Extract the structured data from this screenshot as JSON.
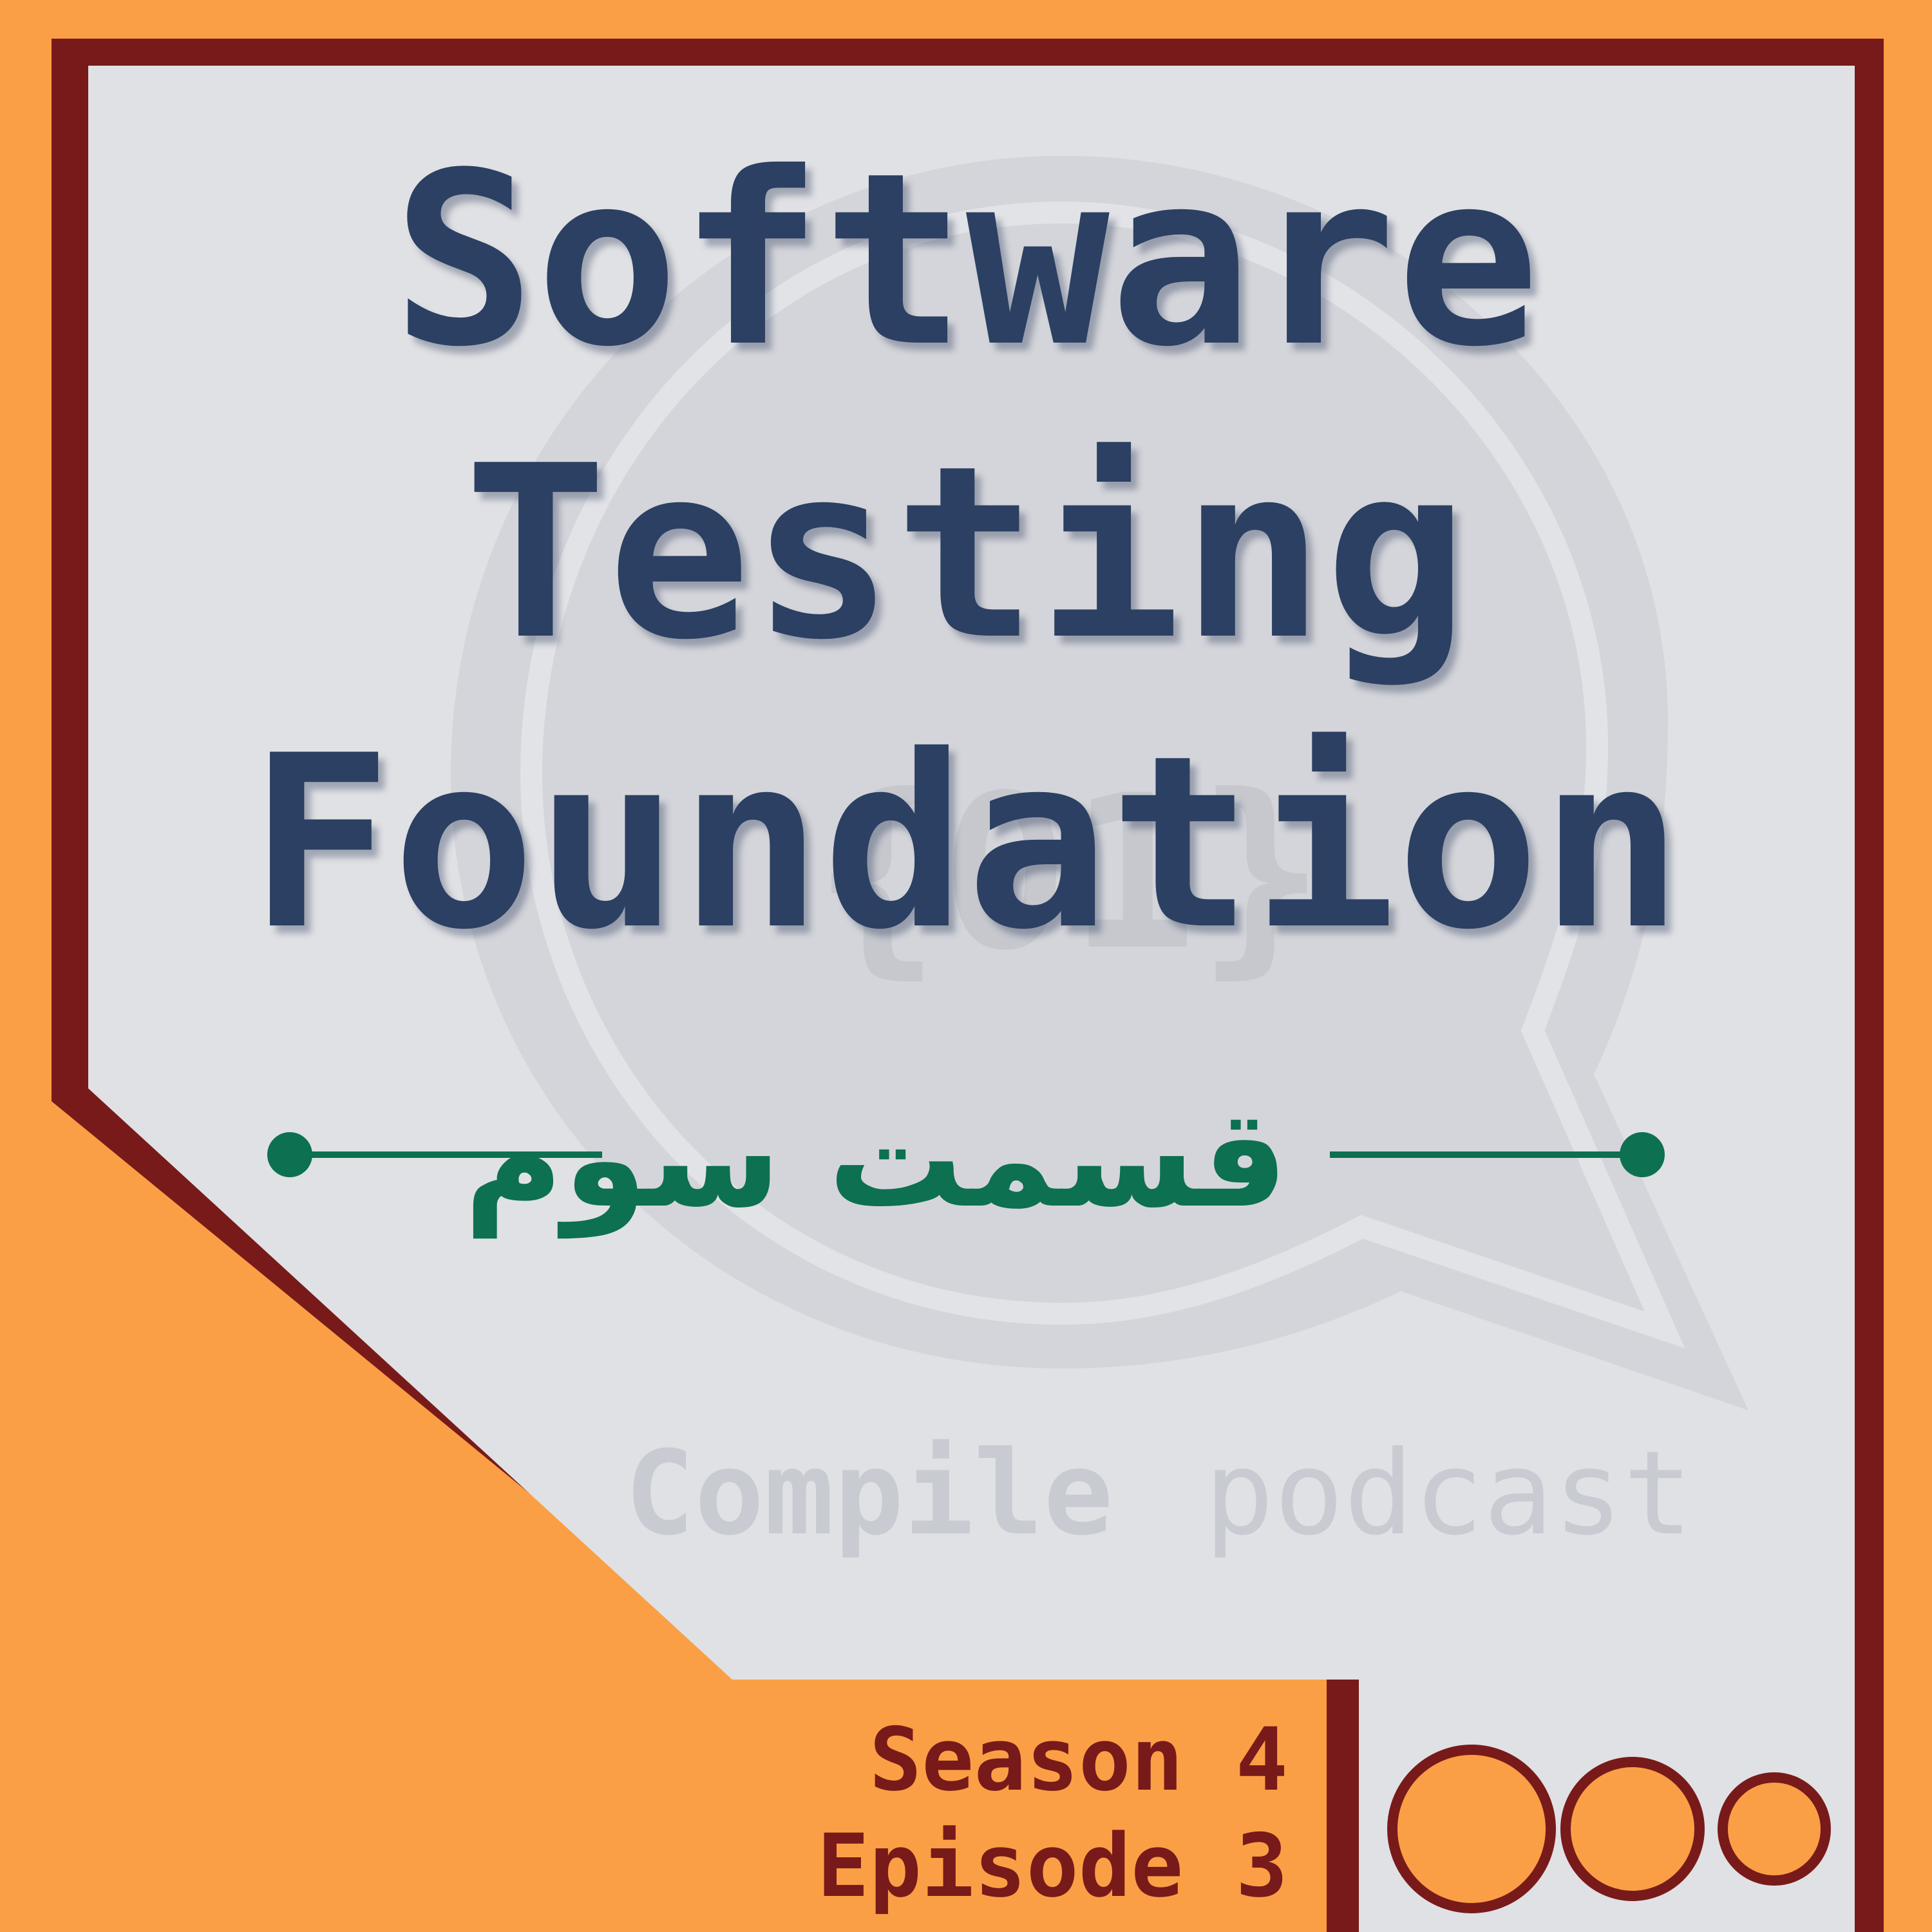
{
  "cover": {
    "title_lines": [
      "Software",
      "Testing",
      "Foundation"
    ],
    "subtitle": "قسمت سوم",
    "brand": {
      "name_bold": "Compile",
      "name_light": "podcast"
    },
    "season_label": "Season 4",
    "episode_label": "Episode 3"
  },
  "colors": {
    "background": "#FA9F45",
    "frame": "#781A1A",
    "panel": "#E0E1E4",
    "title": "#2B4062",
    "subtitle": "#0D7050",
    "watermark": "#C9CBD2"
  },
  "icons": [
    "speech-bubble-logo-icon",
    "three-circles-icon",
    "divider-dot-icon"
  ]
}
